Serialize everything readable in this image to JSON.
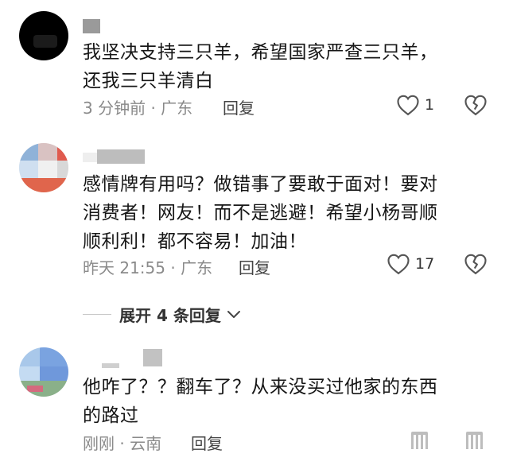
{
  "comments": [
    {
      "text_lines": [
        "我坚决支持三只羊，希望国家严查三只羊，",
        "还我三只羊清白"
      ],
      "meta": "3 分钟前 · 广东",
      "reply_label": "回复",
      "like_count": "1"
    },
    {
      "text_lines": [
        "感情牌有用吗？做错事了要敢于面对！要对",
        "消费者！网友！而不是逃避！希望小杨哥顺",
        "顺利利！都不容易！加油！"
      ],
      "meta": "昨天 21:55 · 广东",
      "reply_label": "回复",
      "like_count": "17"
    },
    {
      "text_lines": [
        "他咋了？？翻车了？从来没买过他家的东西",
        "的路过"
      ],
      "meta": "刚刚 · 云南",
      "reply_label": "回复",
      "like_count": ""
    }
  ],
  "expand_replies": {
    "label": "展开 4 条回复"
  },
  "icons": {
    "like": "heart-outline-icon",
    "dislike": "broken-heart-icon",
    "expand": "chevron-down-icon"
  },
  "colors": {
    "text": "#161616",
    "meta": "#8a8a8a",
    "icon": "#555555"
  }
}
